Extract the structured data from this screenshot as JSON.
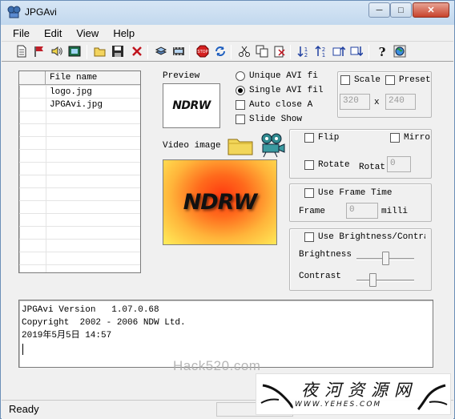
{
  "window": {
    "title": "JPGAvi"
  },
  "menu": [
    "File",
    "Edit",
    "View",
    "Help"
  ],
  "toolbar_icons": [
    "new-icon",
    "flag-icon",
    "speaker-icon",
    "film-icon",
    "open-icon",
    "save-icon",
    "delete-icon",
    "stack-icon",
    "filmstrip-icon",
    "stop-icon",
    "refresh-icon",
    "cut-icon",
    "copy-icon",
    "paste-icon",
    "sort-asc-icon",
    "sort-desc-icon",
    "move-up-icon",
    "move-down-icon",
    "help-icon",
    "globe-icon"
  ],
  "filelist": {
    "header": "File name",
    "rows": [
      "logo.jpg",
      "JPGAvi.jpg"
    ]
  },
  "preview": {
    "label": "Preview",
    "thumb_text": "NDRW"
  },
  "output_options": {
    "unique_avi": "Unique AVI file",
    "single_avi": "Single AVI fil",
    "auto_close": "Auto close A",
    "slide_show": "Slide Show"
  },
  "video": {
    "label": "Video image",
    "image_text": "NDRW"
  },
  "scale": {
    "scale_label": "Scale",
    "preset_label": "Preset",
    "width": "320",
    "x_label": "x",
    "height": "240"
  },
  "transform": {
    "flip_label": "Flip",
    "mirror_label": "Mirro",
    "rotate_label": "Rotate",
    "rotate_angle_label": "Rotat",
    "rotate_value": "0"
  },
  "frame_time": {
    "use_label": "Use Frame Time",
    "frame_label": "Frame",
    "frame_value": "0",
    "unit": "milli"
  },
  "brightness": {
    "use_label": "Use Brightness/Contra",
    "brightness_label": "Brightness",
    "contrast_label": "Contrast",
    "brightness_level": 0.5,
    "contrast_level": 0.25
  },
  "console": {
    "lines": [
      "JPGAvi Version   1.07.0.68",
      "Copyright  2002 - 2006 NDW Ltd.",
      "2019年5月5日 14:57"
    ]
  },
  "status": {
    "text": "Ready"
  },
  "overlay": {
    "watermark": "Hack520.com",
    "site_name": "夜河资源网",
    "site_url": "WWW.YEHES.COM"
  }
}
